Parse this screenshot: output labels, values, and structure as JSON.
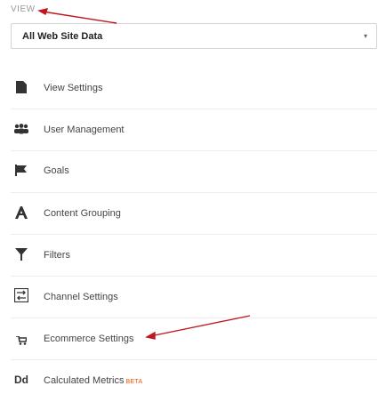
{
  "view": {
    "label": "VIEW"
  },
  "select": {
    "value": "All Web Site Data",
    "caret": "▾"
  },
  "menu": [
    {
      "label": "View Settings",
      "icon": "document-icon",
      "glyph": "▌"
    },
    {
      "label": "User Management",
      "icon": "users-icon",
      "glyph": "∷"
    },
    {
      "label": "Goals",
      "icon": "flag-icon",
      "glyph": "⚑"
    },
    {
      "label": "Content Grouping",
      "icon": "content-grouping-icon",
      "glyph": "Λ"
    },
    {
      "label": "Filters",
      "icon": "filter-icon",
      "glyph": "Y"
    },
    {
      "label": "Channel Settings",
      "icon": "channel-settings-icon",
      "glyph": "⇄"
    },
    {
      "label": "Ecommerce Settings",
      "icon": "cart-icon",
      "glyph": "⍨"
    },
    {
      "label": "Calculated Metrics",
      "icon": "calculated-metrics-icon",
      "glyph": "Dd",
      "badge": "BETA"
    }
  ],
  "colors": {
    "annotation_arrow": "#c0161e",
    "beta": "#ff4e00"
  }
}
